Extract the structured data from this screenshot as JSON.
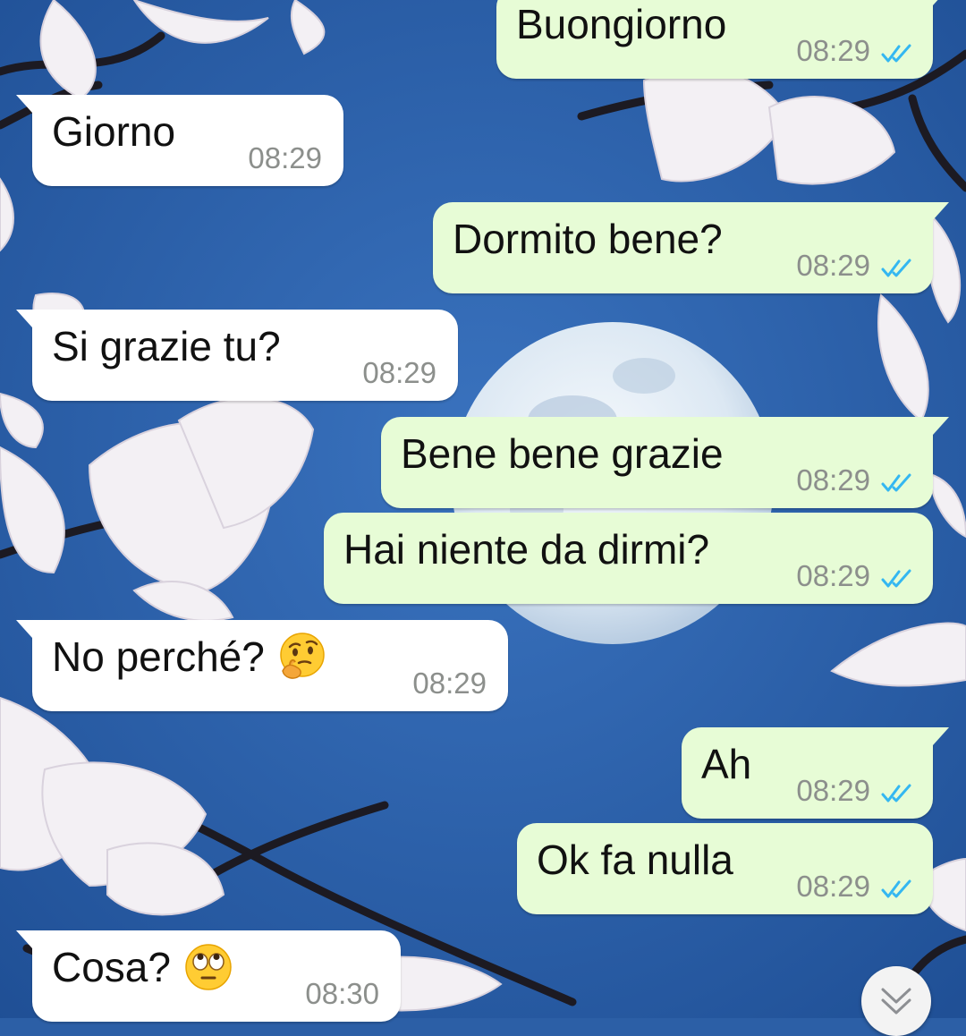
{
  "chat": {
    "messages": [
      {
        "direction": "out",
        "text": "Buongiorno",
        "time": "08:29",
        "status": "read"
      },
      {
        "direction": "in",
        "text": "Giorno",
        "time": "08:29"
      },
      {
        "direction": "out",
        "text": "Dormito bene?",
        "time": "08:29",
        "status": "read"
      },
      {
        "direction": "in",
        "text": "Si grazie tu?",
        "time": "08:29"
      },
      {
        "direction": "out",
        "text": "Bene bene grazie",
        "time": "08:29",
        "status": "read"
      },
      {
        "direction": "out",
        "text": "Hai niente da dirmi?",
        "time": "08:29",
        "status": "read"
      },
      {
        "direction": "in",
        "text": "No perché?",
        "emoji": "thinking-face-icon",
        "time": "08:29"
      },
      {
        "direction": "out",
        "text": "Ah",
        "time": "08:29",
        "status": "read"
      },
      {
        "direction": "out",
        "text": "Ok fa nulla",
        "time": "08:29",
        "status": "read"
      },
      {
        "direction": "in",
        "text": "Cosa?",
        "emoji": "face-with-rolling-eyes-icon",
        "time": "08:30"
      }
    ]
  },
  "colors": {
    "outgoing_bubble": "#e7fcd6",
    "incoming_bubble": "#ffffff",
    "read_ticks": "#34b7f1",
    "wallpaper_sky": "#2c5fa6"
  },
  "icons": {
    "read_ticks": "double-check-icon",
    "scroll_button": "chevron-double-down-icon"
  }
}
